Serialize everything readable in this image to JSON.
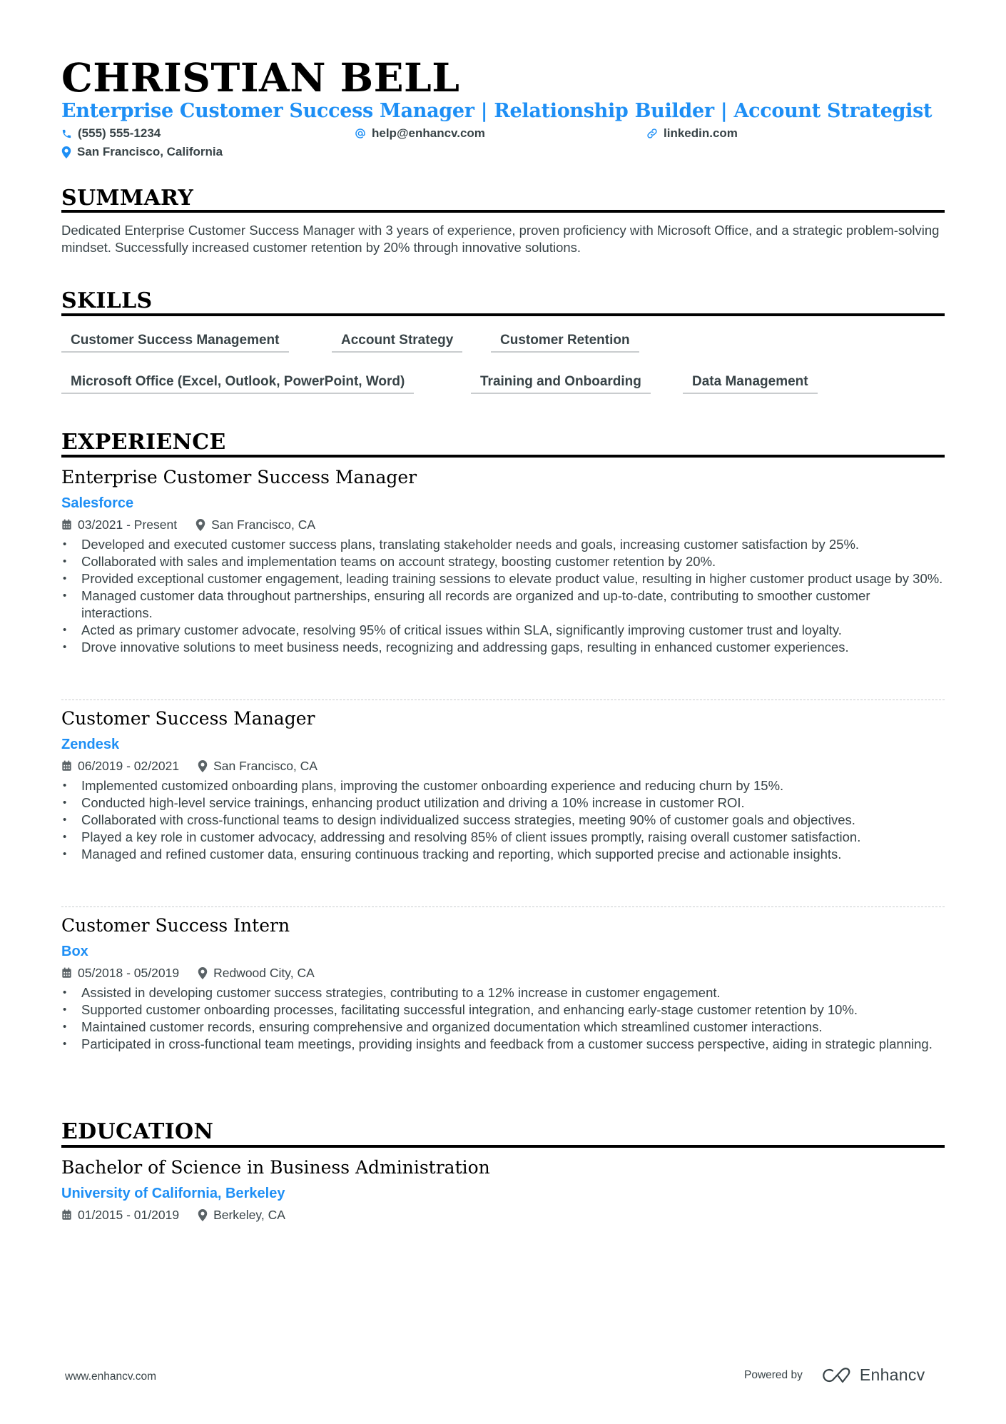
{
  "header": {
    "name": "CHRISTIAN BELL",
    "headline": "Enterprise Customer Success Manager | Relationship Builder | Account Strategist",
    "contact": {
      "phone": "(555) 555-1234",
      "email": "help@enhancv.com",
      "link": "linkedin.com",
      "location": "San Francisco, California"
    }
  },
  "colors": {
    "accent": "#1E8FF5",
    "text": "#384347",
    "heading": "#000000"
  },
  "summary": {
    "title": "SUMMARY",
    "text": "Dedicated Enterprise Customer Success Manager with 3 years of experience, proven proficiency with Microsoft Office, and a strategic problem-solving mindset. Successfully increased customer retention by 20% through innovative solutions."
  },
  "skills": {
    "title": "SKILLS",
    "items": [
      "Customer Success Management",
      "Account Strategy",
      "Customer Retention",
      "Microsoft Office (Excel, Outlook, PowerPoint, Word)",
      "Training and Onboarding",
      "Data Management"
    ]
  },
  "experience": {
    "title": "EXPERIENCE",
    "jobs": [
      {
        "title": "Enterprise Customer Success Manager",
        "company": "Salesforce",
        "dates": "03/2021 - Present",
        "location": "San Francisco, CA",
        "bullets": [
          "Developed and executed customer success plans, translating stakeholder needs and goals, increasing customer satisfaction by 25%.",
          "Collaborated with sales and implementation teams on account strategy, boosting customer retention by 20%.",
          "Provided exceptional customer engagement, leading training sessions to elevate product value, resulting in higher customer product usage by 30%.",
          "Managed customer data throughout partnerships, ensuring all records are organized and up-to-date, contributing to smoother customer interactions.",
          "Acted as primary customer advocate, resolving 95% of critical issues within SLA, significantly improving customer trust and loyalty.",
          "Drove innovative solutions to meet business needs, recognizing and addressing gaps, resulting in enhanced customer experiences."
        ]
      },
      {
        "title": "Customer Success Manager",
        "company": "Zendesk",
        "dates": "06/2019 - 02/2021",
        "location": "San Francisco, CA",
        "bullets": [
          "Implemented customized onboarding plans, improving the customer onboarding experience and reducing churn by 15%.",
          "Conducted high-level service trainings, enhancing product utilization and driving a 10% increase in customer ROI.",
          "Collaborated with cross-functional teams to design individualized success strategies, meeting 90% of customer goals and objectives.",
          "Played a key role in customer advocacy, addressing and resolving 85% of client issues promptly, raising overall customer satisfaction.",
          "Managed and refined customer data, ensuring continuous tracking and reporting, which supported precise and actionable insights."
        ]
      },
      {
        "title": "Customer Success Intern",
        "company": "Box",
        "dates": "05/2018 - 05/2019",
        "location": "Redwood City, CA",
        "bullets": [
          "Assisted in developing customer success strategies, contributing to a 12% increase in customer engagement.",
          "Supported customer onboarding processes, facilitating successful integration, and enhancing early-stage customer retention by 10%.",
          "Maintained customer records, ensuring comprehensive and organized documentation which streamlined customer interactions.",
          "Participated in cross-functional team meetings, providing insights and feedback from a customer success perspective, aiding in strategic planning."
        ]
      }
    ]
  },
  "education": {
    "title": "EDUCATION",
    "degree": "Bachelor of Science in Business Administration",
    "school": "University of California, Berkeley",
    "dates": "01/2015 - 01/2019",
    "location": "Berkeley, CA"
  },
  "footer": {
    "website": "www.enhancv.com",
    "powered_by": "Powered by",
    "brand": "Enhancv"
  }
}
